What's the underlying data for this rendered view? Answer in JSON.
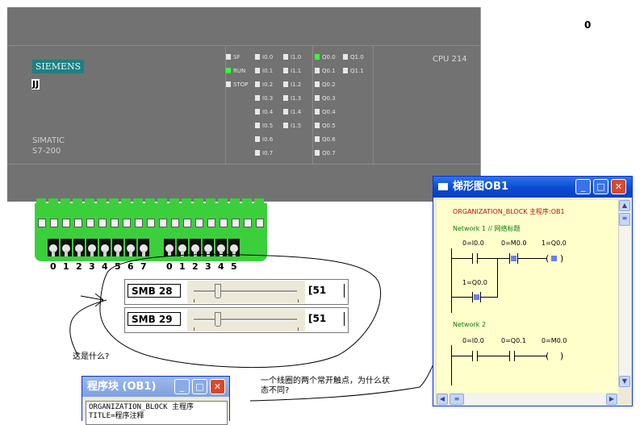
{
  "counter": "0",
  "plc": {
    "brand": "SIEMENS",
    "tag": "JJ",
    "family": "SIMATIC",
    "model": "S7-200",
    "cpu": "CPU 214",
    "status_leds": [
      {
        "label": "SF",
        "on": false
      },
      {
        "label": "RUN",
        "on": true
      },
      {
        "label": "STOP",
        "on": false
      }
    ],
    "input_leds_a": [
      "I0.0",
      "I0.1",
      "I0.2",
      "I0.3",
      "I0.4",
      "I0.5",
      "I0.6",
      "I0.7"
    ],
    "input_leds_b": [
      "I1.0",
      "I1.1",
      "I1.2",
      "I1.3",
      "I1.4",
      "I1.5"
    ],
    "output_leds_a": [
      {
        "label": "Q0.0",
        "on": true
      },
      {
        "label": "Q0.1",
        "on": false
      },
      {
        "label": "Q0.2",
        "on": false
      },
      {
        "label": "Q0.3",
        "on": false
      },
      {
        "label": "Q0.4",
        "on": false
      },
      {
        "label": "Q0.5",
        "on": false
      },
      {
        "label": "Q0.6",
        "on": false
      },
      {
        "label": "Q0.7",
        "on": false
      }
    ],
    "output_leds_b": [
      "Q1.0",
      "Q1.1"
    ]
  },
  "switches": {
    "group_a": [
      "0",
      "1",
      "2",
      "3",
      "4",
      "5",
      "6",
      "7"
    ],
    "group_b": [
      "0",
      "1",
      "2",
      "3",
      "4",
      "5"
    ]
  },
  "smb": [
    {
      "name": "SMB 28",
      "value": "[51",
      "position": 0.23
    },
    {
      "name": "SMB 29",
      "value": "[51",
      "position": 0.23
    }
  ],
  "ladder_window": {
    "title": "梯形图OB1",
    "header": "ORGANIZATION_BLOCK 主程序:OB1",
    "network1": "Network 1 // 网络标题",
    "n1_contact1": "0=I0.0",
    "n1_contact2": "0=M0.0",
    "n1_coil": "1=Q0.0",
    "n1_branch": "1=Q0.0",
    "network2": "Network 2",
    "n2_contact1": "0=I0.0",
    "n2_contact2": "0=Q0.1",
    "n2_coil": "0=M0.0"
  },
  "program_window": {
    "title": "程序块 (OB1)",
    "line1": "ORGANIZATION_BLOCK 主程序",
    "line2": "TITLE=程序注释"
  },
  "annotations": {
    "question1": "这是什么?",
    "question2_line1": "一个线圈的两个常开触点，为什么状",
    "question2_line2": "态不同?"
  }
}
